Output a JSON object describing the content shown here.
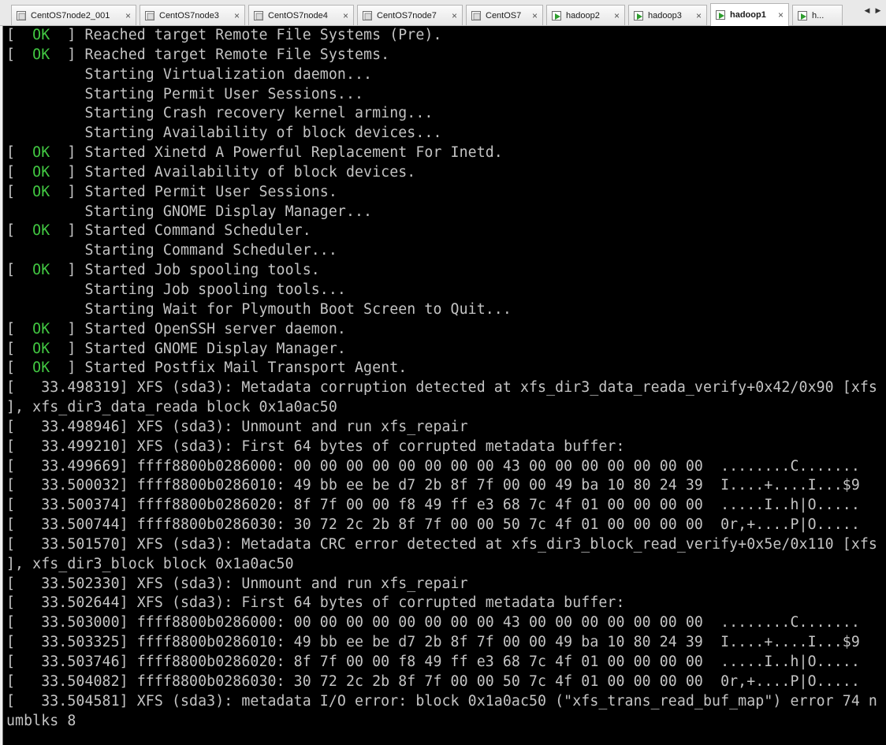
{
  "tabs": [
    {
      "label": "CentOS7node2_001",
      "active": false
    },
    {
      "label": "CentOS7node3",
      "active": false
    },
    {
      "label": "CentOS7node4",
      "active": false
    },
    {
      "label": "CentOS7node7",
      "active": false
    },
    {
      "label": "CentOS7",
      "active": false
    },
    {
      "label": "hadoop2",
      "active": false
    },
    {
      "label": "hadoop3",
      "active": false
    },
    {
      "label": "hadoop1",
      "active": true
    },
    {
      "label": "h...",
      "active": false
    }
  ],
  "tab_close_glyph": "×",
  "tab_scroll_left": "◀",
  "tab_scroll_right": "▶",
  "colors": {
    "console_bg": "#000000",
    "console_text": "#c4c4c4",
    "ok_text": "#42c842",
    "running_icon_play": "#2e9d2e"
  },
  "console": {
    "lines": [
      {
        "pre": "[  ",
        "ok": "OK",
        "post": "  ] Reached target Remote File Systems (Pre)."
      },
      {
        "pre": "[  ",
        "ok": "OK",
        "post": "  ] Reached target Remote File Systems."
      },
      {
        "pre": "         Starting Virtualization daemon..."
      },
      {
        "pre": "         Starting Permit User Sessions..."
      },
      {
        "pre": "         Starting Crash recovery kernel arming..."
      },
      {
        "pre": "         Starting Availability of block devices..."
      },
      {
        "pre": "[  ",
        "ok": "OK",
        "post": "  ] Started Xinetd A Powerful Replacement For Inetd."
      },
      {
        "pre": "[  ",
        "ok": "OK",
        "post": "  ] Started Availability of block devices."
      },
      {
        "pre": "[  ",
        "ok": "OK",
        "post": "  ] Started Permit User Sessions."
      },
      {
        "pre": "         Starting GNOME Display Manager..."
      },
      {
        "pre": "[  ",
        "ok": "OK",
        "post": "  ] Started Command Scheduler."
      },
      {
        "pre": "         Starting Command Scheduler..."
      },
      {
        "pre": "[  ",
        "ok": "OK",
        "post": "  ] Started Job spooling tools."
      },
      {
        "pre": "         Starting Job spooling tools..."
      },
      {
        "pre": "         Starting Wait for Plymouth Boot Screen to Quit..."
      },
      {
        "pre": "[  ",
        "ok": "OK",
        "post": "  ] Started OpenSSH server daemon."
      },
      {
        "pre": "[  ",
        "ok": "OK",
        "post": "  ] Started GNOME Display Manager."
      },
      {
        "pre": "[  ",
        "ok": "OK",
        "post": "  ] Started Postfix Mail Transport Agent."
      },
      {
        "pre": "[   33.498319] XFS (sda3): Metadata corruption detected at xfs_dir3_data_reada_verify+0x42/0x90 [xfs"
      },
      {
        "pre": "], xfs_dir3_data_reada block 0x1a0ac50"
      },
      {
        "pre": "[   33.498946] XFS (sda3): Unmount and run xfs_repair"
      },
      {
        "pre": "[   33.499210] XFS (sda3): First 64 bytes of corrupted metadata buffer:"
      },
      {
        "pre": "[   33.499669] ffff8800b0286000: 00 00 00 00 00 00 00 00 43 00 00 00 00 00 00 00  ........C......."
      },
      {
        "pre": "[   33.500032] ffff8800b0286010: 49 bb ee be d7 2b 8f 7f 00 00 49 ba 10 80 24 39  I....+....I...$9"
      },
      {
        "pre": "[   33.500374] ffff8800b0286020: 8f 7f 00 00 f8 49 ff e3 68 7c 4f 01 00 00 00 00  .....I..h|O....."
      },
      {
        "pre": "[   33.500744] ffff8800b0286030: 30 72 2c 2b 8f 7f 00 00 50 7c 4f 01 00 00 00 00  0r,+....P|O....."
      },
      {
        "pre": "[   33.501570] XFS (sda3): Metadata CRC error detected at xfs_dir3_block_read_verify+0x5e/0x110 [xfs"
      },
      {
        "pre": "], xfs_dir3_block block 0x1a0ac50"
      },
      {
        "pre": "[   33.502330] XFS (sda3): Unmount and run xfs_repair"
      },
      {
        "pre": "[   33.502644] XFS (sda3): First 64 bytes of corrupted metadata buffer:"
      },
      {
        "pre": "[   33.503000] ffff8800b0286000: 00 00 00 00 00 00 00 00 43 00 00 00 00 00 00 00  ........C......."
      },
      {
        "pre": "[   33.503325] ffff8800b0286010: 49 bb ee be d7 2b 8f 7f 00 00 49 ba 10 80 24 39  I....+....I...$9"
      },
      {
        "pre": "[   33.503746] ffff8800b0286020: 8f 7f 00 00 f8 49 ff e3 68 7c 4f 01 00 00 00 00  .....I..h|O....."
      },
      {
        "pre": "[   33.504082] ffff8800b0286030: 30 72 2c 2b 8f 7f 00 00 50 7c 4f 01 00 00 00 00  0r,+....P|O....."
      },
      {
        "pre": "[   33.504581] XFS (sda3): metadata I/O error: block 0x1a0ac50 (\"xfs_trans_read_buf_map\") error 74 n"
      },
      {
        "pre": "umblks 8"
      }
    ]
  }
}
